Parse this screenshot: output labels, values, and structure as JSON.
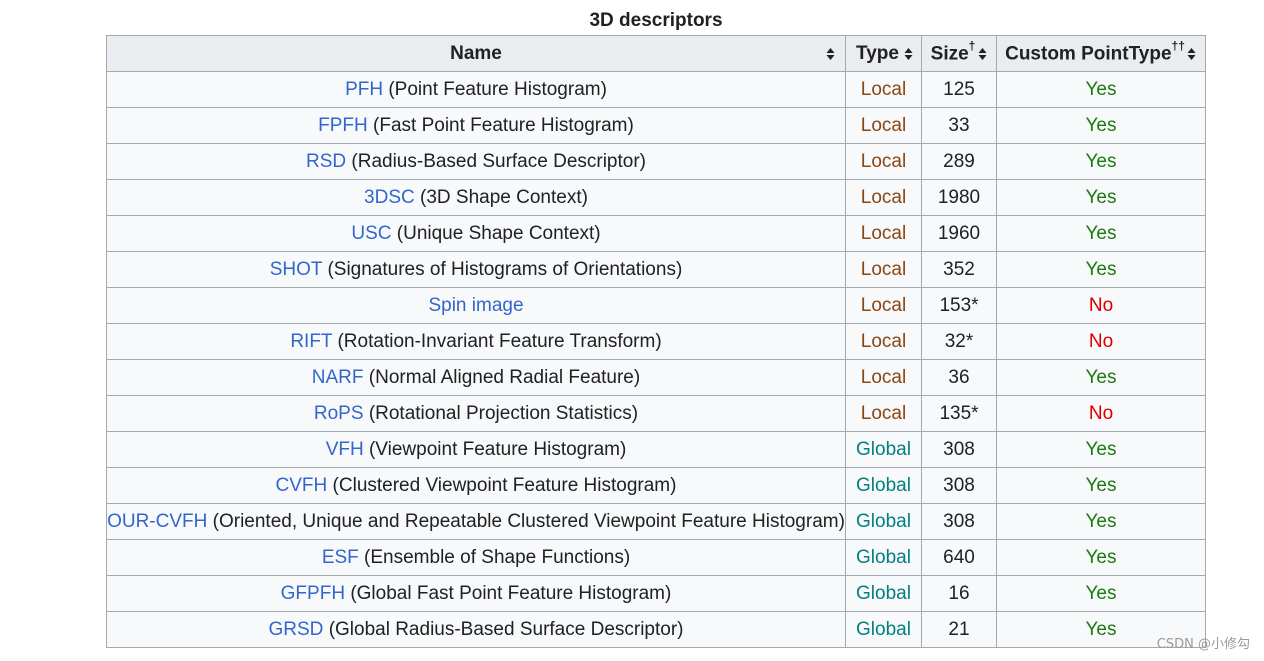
{
  "caption": "3D descriptors",
  "headers": {
    "name": "Name",
    "type": "Type",
    "size": "Size",
    "size_sup": "†",
    "custom": "Custom PointType",
    "custom_sup": "††"
  },
  "rows": [
    {
      "abbr": "PFH",
      "desc": "(Point Feature Histogram)",
      "type": "Local",
      "size": "125",
      "custom": "Yes"
    },
    {
      "abbr": "FPFH",
      "desc": "(Fast Point Feature Histogram)",
      "type": "Local",
      "size": "33",
      "custom": "Yes"
    },
    {
      "abbr": "RSD",
      "desc": "(Radius-Based Surface Descriptor)",
      "type": "Local",
      "size": "289",
      "custom": "Yes"
    },
    {
      "abbr": "3DSC",
      "desc": "(3D Shape Context)",
      "type": "Local",
      "size": "1980",
      "custom": "Yes"
    },
    {
      "abbr": "USC",
      "desc": "(Unique Shape Context)",
      "type": "Local",
      "size": "1960",
      "custom": "Yes"
    },
    {
      "abbr": "SHOT",
      "desc": "(Signatures of Histograms of Orientations)",
      "type": "Local",
      "size": "352",
      "custom": "Yes"
    },
    {
      "abbr": "Spin image",
      "desc": "",
      "type": "Local",
      "size": "153*",
      "custom": "No"
    },
    {
      "abbr": "RIFT",
      "desc": "(Rotation-Invariant Feature Transform)",
      "type": "Local",
      "size": "32*",
      "custom": "No"
    },
    {
      "abbr": "NARF",
      "desc": "(Normal Aligned Radial Feature)",
      "type": "Local",
      "size": "36",
      "custom": "Yes"
    },
    {
      "abbr": "RoPS",
      "desc": "(Rotational Projection Statistics)",
      "type": "Local",
      "size": "135*",
      "custom": "No"
    },
    {
      "abbr": "VFH",
      "desc": "(Viewpoint Feature Histogram)",
      "type": "Global",
      "size": "308",
      "custom": "Yes"
    },
    {
      "abbr": "CVFH",
      "desc": "(Clustered Viewpoint Feature Histogram)",
      "type": "Global",
      "size": "308",
      "custom": "Yes"
    },
    {
      "abbr": "OUR-CVFH",
      "desc": "(Oriented, Unique and Repeatable Clustered Viewpoint Feature Histogram)",
      "type": "Global",
      "size": "308",
      "custom": "Yes"
    },
    {
      "abbr": "ESF",
      "desc": "(Ensemble of Shape Functions)",
      "type": "Global",
      "size": "640",
      "custom": "Yes"
    },
    {
      "abbr": "GFPFH",
      "desc": "(Global Fast Point Feature Histogram)",
      "type": "Global",
      "size": "16",
      "custom": "Yes"
    },
    {
      "abbr": "GRSD",
      "desc": "(Global Radius-Based Surface Descriptor)",
      "type": "Global",
      "size": "21",
      "custom": "Yes"
    }
  ],
  "watermark": "CSDN @小修勾",
  "colors": {
    "link": "#3366cc",
    "local": "#8b4513",
    "global": "#008080",
    "yes": "#1a7a12",
    "no": "#dd0000",
    "header_bg": "#eaecf0",
    "cell_bg": "#f8f9fa",
    "border": "#a2a9b1"
  },
  "icons": {
    "sort": "sort-arrows-icon"
  }
}
